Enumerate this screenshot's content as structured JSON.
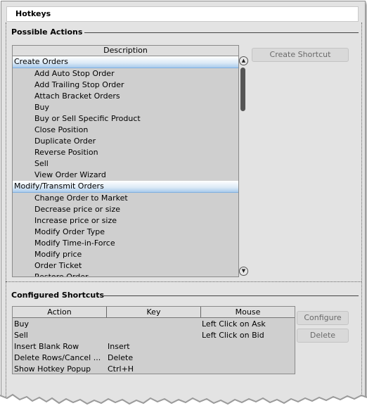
{
  "window": {
    "title": "Hotkeys"
  },
  "possible_actions": {
    "section_title": "Possible Actions",
    "column_header": "Description",
    "groups": [
      {
        "label": "Create Orders",
        "items": [
          "Add Auto Stop Order",
          "Add Trailing Stop Order",
          "Attach Bracket Orders",
          "Buy",
          "Buy or Sell Specific Product",
          "Close Position",
          "Duplicate Order",
          "Reverse Position",
          "Sell",
          "View Order Wizard"
        ]
      },
      {
        "label": "Modify/Transmit Orders",
        "items": [
          "Change Order to Market",
          "Decrease price or size",
          "Increase price or size",
          "Modify Order Type",
          "Modify Time-in-Force",
          "Modify price",
          "Order Ticket",
          "Restore Order"
        ]
      }
    ],
    "create_shortcut_label": "Create Shortcut"
  },
  "configured_shortcuts": {
    "section_title": "Configured Shortcuts",
    "headers": {
      "action": "Action",
      "key": "Key",
      "mouse": "Mouse"
    },
    "rows": [
      {
        "action": "Buy",
        "key": "",
        "mouse": "Left Click on Ask"
      },
      {
        "action": "Sell",
        "key": "",
        "mouse": "Left Click on Bid"
      },
      {
        "action": "Insert Blank Row",
        "key": "Insert",
        "mouse": ""
      },
      {
        "action": "Delete Rows/Cancel ...",
        "key": "Delete",
        "mouse": ""
      },
      {
        "action": "Show Hotkey Popup",
        "key": "Ctrl+H",
        "mouse": ""
      }
    ],
    "configure_label": "Configure",
    "delete_label": "Delete"
  },
  "icons": {
    "scroll_up": "chevron-up-icon",
    "scroll_down": "chevron-down-icon"
  }
}
